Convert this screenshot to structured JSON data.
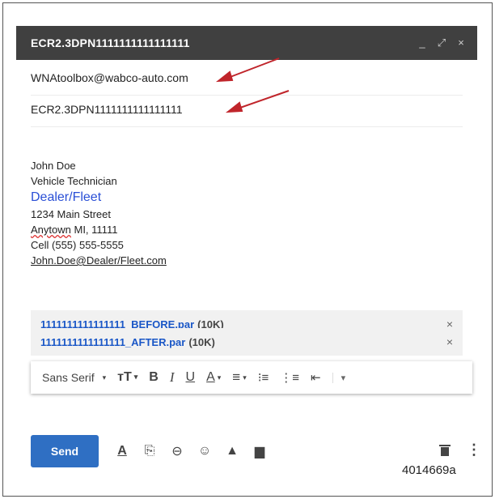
{
  "window": {
    "title": "ECR2.3DPN1111111111111111",
    "minimize_glyph": "_",
    "expand_glyph": "⤢",
    "close_glyph": "×"
  },
  "fields": {
    "to": "WNAtoolbox@wabco-auto.com",
    "subject": "ECR2.3DPN1111111111111111"
  },
  "signature": {
    "name": "John Doe",
    "role": "Vehicle Technician",
    "company": "Dealer/Fleet",
    "street": "1234 Main Street",
    "city_word": "Anytown",
    "city_rest": " MI, 11111",
    "cell": "Cell (555) 555-5555",
    "email": "John.Doe@Dealer/Fleet.com"
  },
  "attachments": [
    {
      "name": "1111111111111111_BEFORE.par",
      "size": "(10K)",
      "remove": "×"
    },
    {
      "name": "1111111111111111_AFTER.par",
      "size": "(10K)",
      "remove": "×"
    }
  ],
  "format_toolbar": {
    "font": "Sans Serif",
    "size_glyph": "ᴛT",
    "bold": "B",
    "italic": "I",
    "underline": "U",
    "text_color": "A",
    "align_glyph": "≡",
    "numbered_glyph": "⁝≡",
    "bulleted_glyph": "⋮≡",
    "indent_glyph": "⇤",
    "more_glyph": "▾",
    "dropdown_glyph": "▾"
  },
  "compose_toolbar": {
    "send_label": "Send",
    "format_glyph": "A",
    "attach_glyph": "⎘",
    "link_glyph": "⊖",
    "emoji_glyph": "☺",
    "drive_glyph": "▲",
    "photo_glyph": "▆",
    "more_glyph": "⋮"
  },
  "figure_id": "4014669a",
  "colors": {
    "titlebar": "#404040",
    "send_button": "#2f6fc3",
    "link_blue": "#1a57c7",
    "arrow": "#c0252b"
  },
  "icons": [
    "minimize-icon",
    "expand-icon",
    "close-icon",
    "trash-icon",
    "more-options-icon"
  ]
}
